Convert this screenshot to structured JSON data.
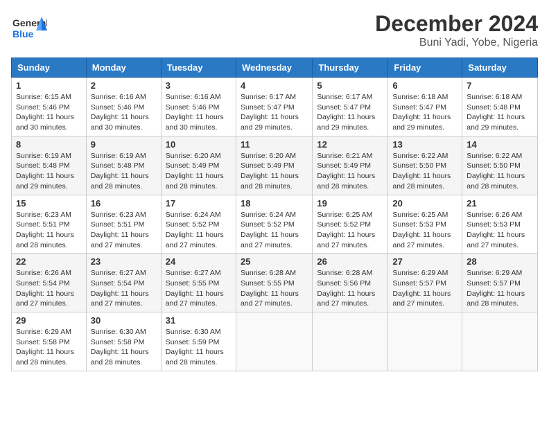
{
  "logo": {
    "text_general": "General",
    "text_blue": "Blue"
  },
  "title": "December 2024",
  "subtitle": "Buni Yadi, Yobe, Nigeria",
  "weekdays": [
    "Sunday",
    "Monday",
    "Tuesday",
    "Wednesday",
    "Thursday",
    "Friday",
    "Saturday"
  ],
  "weeks": [
    [
      {
        "day": "1",
        "sunrise": "6:15 AM",
        "sunset": "5:46 PM",
        "daylight": "11 hours and 30 minutes."
      },
      {
        "day": "2",
        "sunrise": "6:16 AM",
        "sunset": "5:46 PM",
        "daylight": "11 hours and 30 minutes."
      },
      {
        "day": "3",
        "sunrise": "6:16 AM",
        "sunset": "5:46 PM",
        "daylight": "11 hours and 30 minutes."
      },
      {
        "day": "4",
        "sunrise": "6:17 AM",
        "sunset": "5:47 PM",
        "daylight": "11 hours and 29 minutes."
      },
      {
        "day": "5",
        "sunrise": "6:17 AM",
        "sunset": "5:47 PM",
        "daylight": "11 hours and 29 minutes."
      },
      {
        "day": "6",
        "sunrise": "6:18 AM",
        "sunset": "5:47 PM",
        "daylight": "11 hours and 29 minutes."
      },
      {
        "day": "7",
        "sunrise": "6:18 AM",
        "sunset": "5:48 PM",
        "daylight": "11 hours and 29 minutes."
      }
    ],
    [
      {
        "day": "8",
        "sunrise": "6:19 AM",
        "sunset": "5:48 PM",
        "daylight": "11 hours and 29 minutes."
      },
      {
        "day": "9",
        "sunrise": "6:19 AM",
        "sunset": "5:48 PM",
        "daylight": "11 hours and 28 minutes."
      },
      {
        "day": "10",
        "sunrise": "6:20 AM",
        "sunset": "5:49 PM",
        "daylight": "11 hours and 28 minutes."
      },
      {
        "day": "11",
        "sunrise": "6:20 AM",
        "sunset": "5:49 PM",
        "daylight": "11 hours and 28 minutes."
      },
      {
        "day": "12",
        "sunrise": "6:21 AM",
        "sunset": "5:49 PM",
        "daylight": "11 hours and 28 minutes."
      },
      {
        "day": "13",
        "sunrise": "6:22 AM",
        "sunset": "5:50 PM",
        "daylight": "11 hours and 28 minutes."
      },
      {
        "day": "14",
        "sunrise": "6:22 AM",
        "sunset": "5:50 PM",
        "daylight": "11 hours and 28 minutes."
      }
    ],
    [
      {
        "day": "15",
        "sunrise": "6:23 AM",
        "sunset": "5:51 PM",
        "daylight": "11 hours and 28 minutes."
      },
      {
        "day": "16",
        "sunrise": "6:23 AM",
        "sunset": "5:51 PM",
        "daylight": "11 hours and 27 minutes."
      },
      {
        "day": "17",
        "sunrise": "6:24 AM",
        "sunset": "5:52 PM",
        "daylight": "11 hours and 27 minutes."
      },
      {
        "day": "18",
        "sunrise": "6:24 AM",
        "sunset": "5:52 PM",
        "daylight": "11 hours and 27 minutes."
      },
      {
        "day": "19",
        "sunrise": "6:25 AM",
        "sunset": "5:52 PM",
        "daylight": "11 hours and 27 minutes."
      },
      {
        "day": "20",
        "sunrise": "6:25 AM",
        "sunset": "5:53 PM",
        "daylight": "11 hours and 27 minutes."
      },
      {
        "day": "21",
        "sunrise": "6:26 AM",
        "sunset": "5:53 PM",
        "daylight": "11 hours and 27 minutes."
      }
    ],
    [
      {
        "day": "22",
        "sunrise": "6:26 AM",
        "sunset": "5:54 PM",
        "daylight": "11 hours and 27 minutes."
      },
      {
        "day": "23",
        "sunrise": "6:27 AM",
        "sunset": "5:54 PM",
        "daylight": "11 hours and 27 minutes."
      },
      {
        "day": "24",
        "sunrise": "6:27 AM",
        "sunset": "5:55 PM",
        "daylight": "11 hours and 27 minutes."
      },
      {
        "day": "25",
        "sunrise": "6:28 AM",
        "sunset": "5:55 PM",
        "daylight": "11 hours and 27 minutes."
      },
      {
        "day": "26",
        "sunrise": "6:28 AM",
        "sunset": "5:56 PM",
        "daylight": "11 hours and 27 minutes."
      },
      {
        "day": "27",
        "sunrise": "6:29 AM",
        "sunset": "5:57 PM",
        "daylight": "11 hours and 27 minutes."
      },
      {
        "day": "28",
        "sunrise": "6:29 AM",
        "sunset": "5:57 PM",
        "daylight": "11 hours and 28 minutes."
      }
    ],
    [
      {
        "day": "29",
        "sunrise": "6:29 AM",
        "sunset": "5:58 PM",
        "daylight": "11 hours and 28 minutes."
      },
      {
        "day": "30",
        "sunrise": "6:30 AM",
        "sunset": "5:58 PM",
        "daylight": "11 hours and 28 minutes."
      },
      {
        "day": "31",
        "sunrise": "6:30 AM",
        "sunset": "5:59 PM",
        "daylight": "11 hours and 28 minutes."
      },
      null,
      null,
      null,
      null
    ]
  ]
}
